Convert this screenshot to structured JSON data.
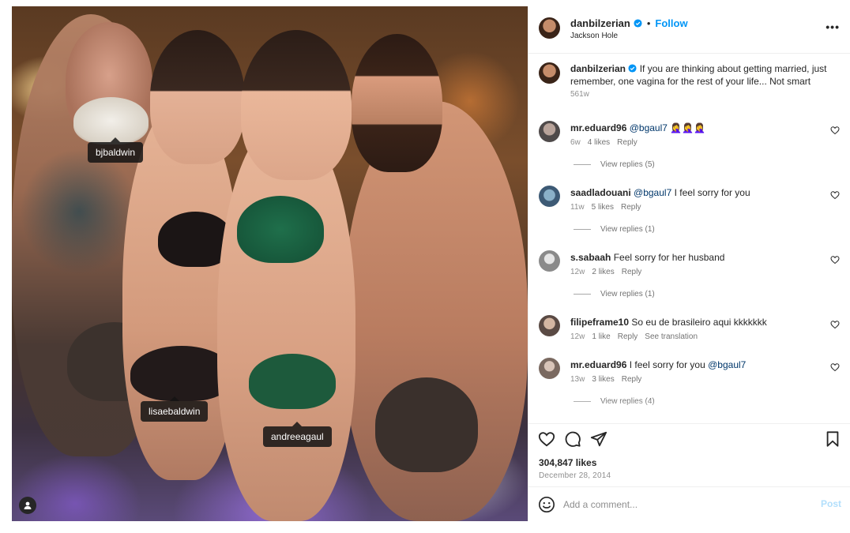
{
  "photo": {
    "tags": [
      "bjbaldwin",
      "lisaebaldwin",
      "andreeagaul"
    ]
  },
  "header": {
    "username": "danbilzerian",
    "separator": "•",
    "follow_label": "Follow",
    "location": "Jackson Hole",
    "more_glyph": "•••"
  },
  "caption": {
    "username": "danbilzerian",
    "text": "If you are thinking about getting married, just remember, one vagina for the rest of your life... Not smart",
    "time": "561w"
  },
  "comments": [
    {
      "username": "mr.eduard96",
      "mention": "@bgaul7",
      "text": "",
      "emoji": "🤦‍♀️🤦‍♀️🤦‍♀️",
      "time": "6w",
      "likes": "4 likes",
      "reply": "Reply",
      "extra": "",
      "view_replies": "View replies (5)"
    },
    {
      "username": "saadladouani",
      "mention": "@bgaul7",
      "text": "I feel sorry for you",
      "time": "11w",
      "likes": "5 likes",
      "reply": "Reply",
      "extra": "",
      "view_replies": "View replies (1)"
    },
    {
      "username": "s.sabaah",
      "text": "Feel sorry for her husband",
      "time": "12w",
      "likes": "2 likes",
      "reply": "Reply",
      "extra": "",
      "view_replies": "View replies (1)"
    },
    {
      "username": "filipeframe10",
      "text": "So eu de brasileiro aqui kkkkkkk",
      "time": "12w",
      "likes": "1 like",
      "reply": "Reply",
      "extra": "See translation",
      "view_replies": ""
    },
    {
      "username": "mr.eduard96",
      "text": "I feel sorry for you",
      "mention_after": "@bgaul7",
      "time": "13w",
      "likes": "3 likes",
      "reply": "Reply",
      "extra": "",
      "view_replies": "View replies (4)"
    }
  ],
  "stats": {
    "likes": "304,847 likes",
    "date": "December 28, 2014"
  },
  "composer": {
    "placeholder": "Add a comment...",
    "post_label": "Post"
  },
  "colors": {
    "accent": "#0095f6",
    "mention": "#00376b",
    "post_disabled": "#b2dffc"
  }
}
